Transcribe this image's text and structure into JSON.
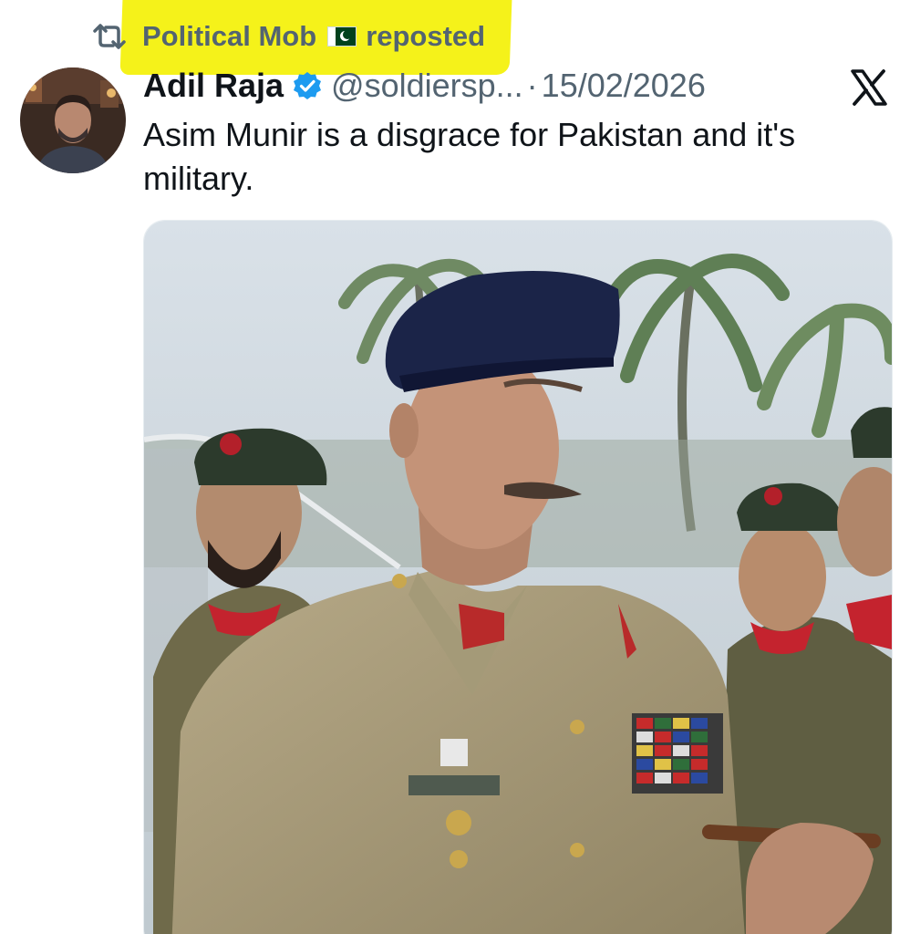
{
  "repost": {
    "icon": "repost-icon",
    "name": "Political Mob",
    "flag_icon": "pakistan-flag-icon",
    "label": "reposted",
    "highlight_color": "#f5f21a"
  },
  "tweet": {
    "author_name": "Adil Raja",
    "verified_icon": "verified-badge-icon",
    "handle": "@soldiersp...",
    "separator": "·",
    "date": "15/02/2026",
    "platform_icon": "x-logo-icon",
    "text": "Asim Munir is a disgrace for Pakistan and it's military."
  },
  "colors": {
    "text_primary": "#0f1419",
    "text_secondary": "#536471",
    "verified_blue": "#1d9bf0"
  }
}
